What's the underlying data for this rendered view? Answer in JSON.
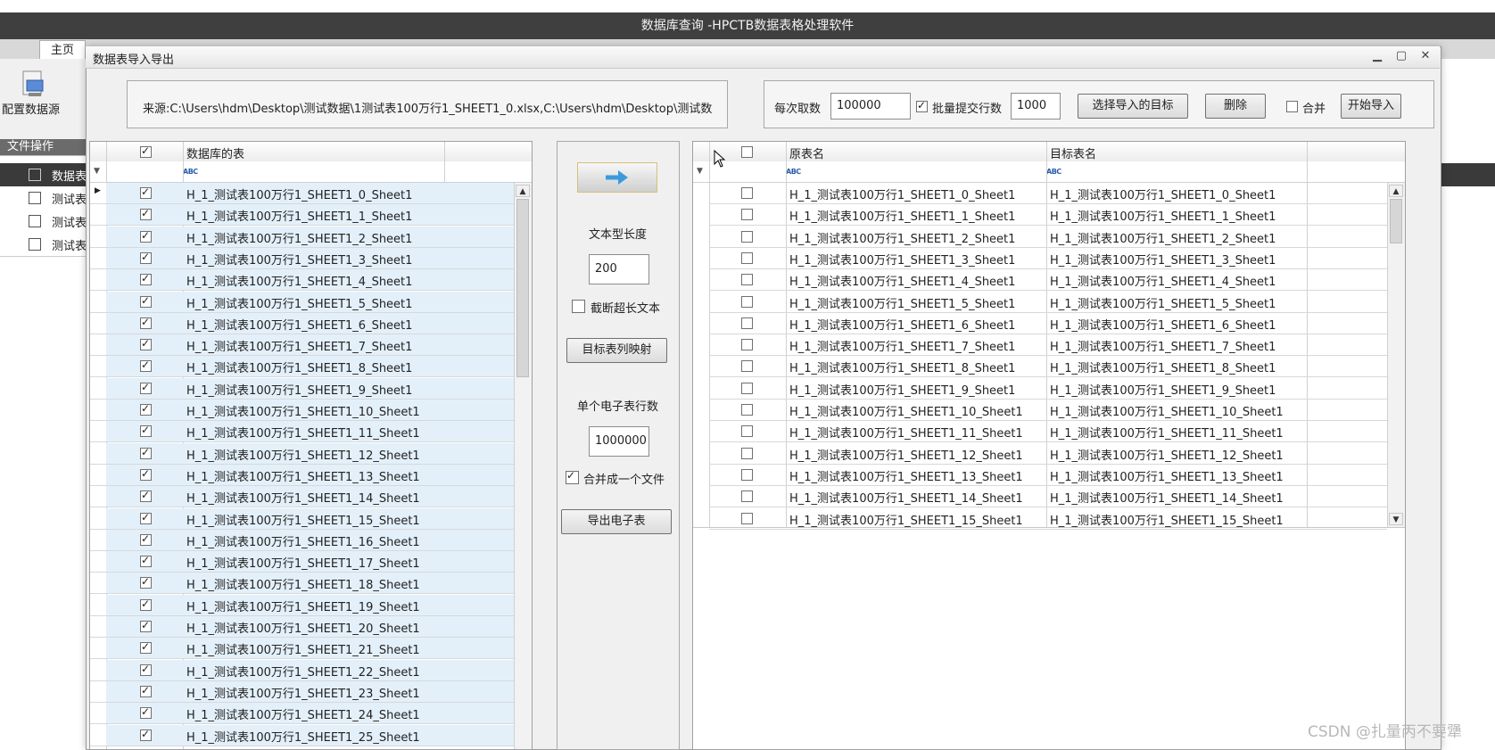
{
  "app": {
    "window_title": "数据库查询 -HPCTB数据表格处理软件",
    "tab_home": "主页",
    "config_source_label": "配置数据源",
    "file_ops_label": "文件操作",
    "bg_grid_header": "数据表",
    "bg_rows": [
      "测试表",
      "测试表",
      "测试表"
    ]
  },
  "dialog": {
    "title": "数据表导入导出",
    "source_label": "来源:",
    "source_value": "C:\\Users\\hdm\\Desktop\\测试数据\\1测试表100万行1_SHEET1_0.xlsx,C:\\Users\\hdm\\Desktop\\测试数",
    "fetch_label": "每次取数",
    "fetch_value": "100000",
    "batch_label": "批量提交行数",
    "batch_value": "1000",
    "select_target_button": "选择导入的目标",
    "delete_button": "删除",
    "merge_label": "合并",
    "start_import_button": "开始导入"
  },
  "left_grid": {
    "header": "数据库的表",
    "rows": [
      "H_1_测试表100万行1_SHEET1_0_Sheet1",
      "H_1_测试表100万行1_SHEET1_1_Sheet1",
      "H_1_测试表100万行1_SHEET1_2_Sheet1",
      "H_1_测试表100万行1_SHEET1_3_Sheet1",
      "H_1_测试表100万行1_SHEET1_4_Sheet1",
      "H_1_测试表100万行1_SHEET1_5_Sheet1",
      "H_1_测试表100万行1_SHEET1_6_Sheet1",
      "H_1_测试表100万行1_SHEET1_7_Sheet1",
      "H_1_测试表100万行1_SHEET1_8_Sheet1",
      "H_1_测试表100万行1_SHEET1_9_Sheet1",
      "H_1_测试表100万行1_SHEET1_10_Sheet1",
      "H_1_测试表100万行1_SHEET1_11_Sheet1",
      "H_1_测试表100万行1_SHEET1_12_Sheet1",
      "H_1_测试表100万行1_SHEET1_13_Sheet1",
      "H_1_测试表100万行1_SHEET1_14_Sheet1",
      "H_1_测试表100万行1_SHEET1_15_Sheet1",
      "H_1_测试表100万行1_SHEET1_16_Sheet1",
      "H_1_测试表100万行1_SHEET1_17_Sheet1",
      "H_1_测试表100万行1_SHEET1_18_Sheet1",
      "H_1_测试表100万行1_SHEET1_19_Sheet1",
      "H_1_测试表100万行1_SHEET1_20_Sheet1",
      "H_1_测试表100万行1_SHEET1_21_Sheet1",
      "H_1_测试表100万行1_SHEET1_22_Sheet1",
      "H_1_测试表100万行1_SHEET1_23_Sheet1",
      "H_1_测试表100万行1_SHEET1_24_Sheet1",
      "H_1_测试表100万行1_SHEET1_25_Sheet1"
    ]
  },
  "middle": {
    "text_length_label": "文本型长度",
    "text_length_value": "200",
    "truncate_label": "截断超长文本",
    "map_columns_button": "目标表列映射",
    "rows_per_sheet_label": "单个电子表行数",
    "rows_per_sheet_value": "1000000",
    "merge_file_label": "合并成一个文件",
    "export_button": "导出电子表"
  },
  "right_grid": {
    "header_source": "原表名",
    "header_target": "目标表名",
    "rows": [
      [
        "H_1_测试表100万行1_SHEET1_0_Sheet1",
        "H_1_测试表100万行1_SHEET1_0_Sheet1"
      ],
      [
        "H_1_测试表100万行1_SHEET1_1_Sheet1",
        "H_1_测试表100万行1_SHEET1_1_Sheet1"
      ],
      [
        "H_1_测试表100万行1_SHEET1_2_Sheet1",
        "H_1_测试表100万行1_SHEET1_2_Sheet1"
      ],
      [
        "H_1_测试表100万行1_SHEET1_3_Sheet1",
        "H_1_测试表100万行1_SHEET1_3_Sheet1"
      ],
      [
        "H_1_测试表100万行1_SHEET1_4_Sheet1",
        "H_1_测试表100万行1_SHEET1_4_Sheet1"
      ],
      [
        "H_1_测试表100万行1_SHEET1_5_Sheet1",
        "H_1_测试表100万行1_SHEET1_5_Sheet1"
      ],
      [
        "H_1_测试表100万行1_SHEET1_6_Sheet1",
        "H_1_测试表100万行1_SHEET1_6_Sheet1"
      ],
      [
        "H_1_测试表100万行1_SHEET1_7_Sheet1",
        "H_1_测试表100万行1_SHEET1_7_Sheet1"
      ],
      [
        "H_1_测试表100万行1_SHEET1_8_Sheet1",
        "H_1_测试表100万行1_SHEET1_8_Sheet1"
      ],
      [
        "H_1_测试表100万行1_SHEET1_9_Sheet1",
        "H_1_测试表100万行1_SHEET1_9_Sheet1"
      ],
      [
        "H_1_测试表100万行1_SHEET1_10_Sheet1",
        "H_1_测试表100万行1_SHEET1_10_Sheet1"
      ],
      [
        "H_1_测试表100万行1_SHEET1_11_Sheet1",
        "H_1_测试表100万行1_SHEET1_11_Sheet1"
      ],
      [
        "H_1_测试表100万行1_SHEET1_12_Sheet1",
        "H_1_测试表100万行1_SHEET1_12_Sheet1"
      ],
      [
        "H_1_测试表100万行1_SHEET1_13_Sheet1",
        "H_1_测试表100万行1_SHEET1_13_Sheet1"
      ],
      [
        "H_1_测试表100万行1_SHEET1_14_Sheet1",
        "H_1_测试表100万行1_SHEET1_14_Sheet1"
      ],
      [
        "H_1_测试表100万行1_SHEET1_15_Sheet1",
        "H_1_测试表100万行1_SHEET1_15_Sheet1"
      ]
    ]
  },
  "watermark": "CSDN @扎量丙不要犟",
  "icons": {
    "filter": "funnel-icon",
    "text_type": "abc-icon",
    "transfer": "arrow-right-icon"
  },
  "colors": {
    "title_bar": "#3f3f3f",
    "selected_row": "#e3f0fa",
    "arrow": "#3a9bdc"
  }
}
